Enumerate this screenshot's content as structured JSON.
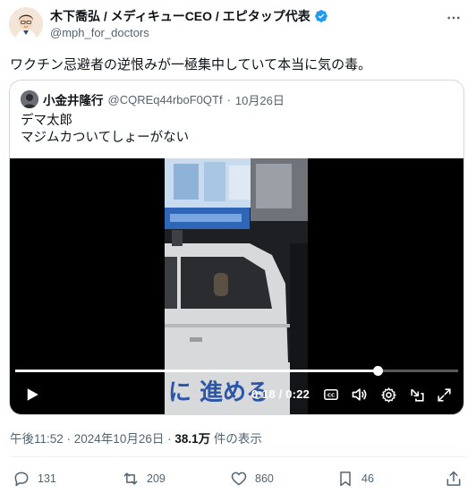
{
  "author": {
    "display_name": "木下喬弘 / メディキューCEO / エピタップ代表",
    "handle": "@mph_for_doctors",
    "verified": true
  },
  "post": {
    "text": "ワクチン忌避者の逆恨みが一極集中していて本当に気の毒。"
  },
  "quoted": {
    "display_name": "小金井隆行",
    "handle": "@CQREq44rboF0QTf",
    "separator": "·",
    "date": "10月26日",
    "text_line1": "デマ太郎",
    "text_line2": "マジムカついてしょーがない"
  },
  "video": {
    "time": "0:18 / 0:22",
    "progress": 0.82,
    "cc_label": "CC",
    "sign_text": "に 進める"
  },
  "meta": {
    "timestamp": "午後11:52 · 2024年10月26日 · ",
    "views": "38.1万",
    "views_suffix": " 件の表示"
  },
  "actions": {
    "replies": "131",
    "reposts": "209",
    "likes": "860",
    "bookmarks": "46"
  },
  "colors": {
    "text_primary": "#0f1419",
    "text_secondary": "#536471",
    "verified_blue": "#1d9bf0",
    "border": "#cfd9de"
  }
}
